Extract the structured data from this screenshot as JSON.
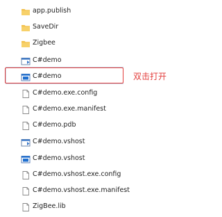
{
  "explorer": {
    "files": [
      {
        "name": "app.publish",
        "icon": "folder-icon"
      },
      {
        "name": "SaveDir",
        "icon": "folder-icon"
      },
      {
        "name": "Zigbee",
        "icon": "folder-icon"
      },
      {
        "name": "C#demo",
        "icon": "csharp-project-icon"
      },
      {
        "name": "C#demo",
        "icon": "application-icon"
      },
      {
        "name": "C#demo.exe.config",
        "icon": "file-icon"
      },
      {
        "name": "C#demo.exe.manifest",
        "icon": "file-icon"
      },
      {
        "name": "C#demo.pdb",
        "icon": "file-icon"
      },
      {
        "name": "C#demo.vshost",
        "icon": "csharp-project-icon"
      },
      {
        "name": "C#demo.vshost",
        "icon": "application-icon"
      },
      {
        "name": "C#demo.vshost.exe.config",
        "icon": "file-icon"
      },
      {
        "name": "C#demo.vshost.exe.manifest",
        "icon": "file-icon"
      },
      {
        "name": "ZigBee.lib",
        "icon": "file-icon"
      }
    ]
  },
  "annotation": {
    "text": "双击打开",
    "color": "#e33e3c"
  },
  "colors": {
    "folder": "#f2c14e",
    "highlight": "#e33e3c",
    "app_blue": "#1e6fd0"
  }
}
